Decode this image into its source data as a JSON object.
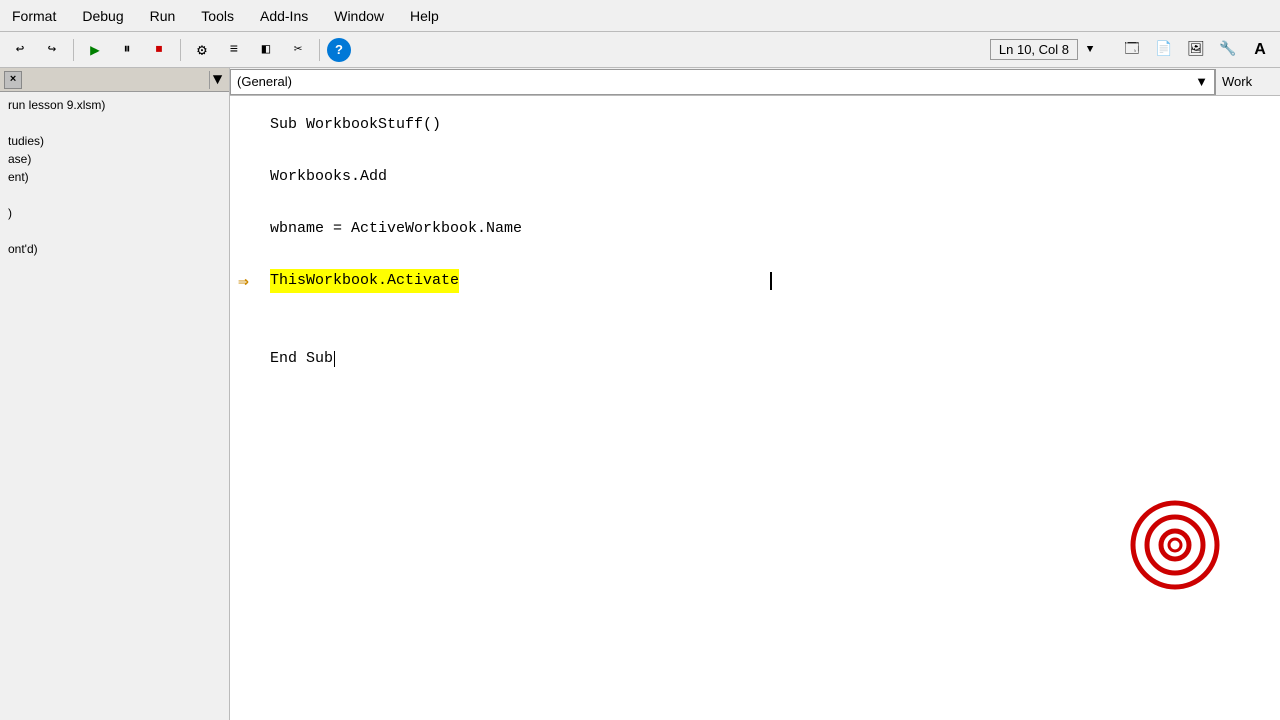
{
  "menu": {
    "items": [
      "Format",
      "Debug",
      "Run",
      "Tools",
      "Add-Ins",
      "Window",
      "Help"
    ]
  },
  "toolbar": {
    "buttons": [
      {
        "name": "undo-btn",
        "icon": "↩",
        "label": "Undo"
      },
      {
        "name": "redo-btn",
        "icon": "↪",
        "label": "Redo"
      },
      {
        "name": "run-btn",
        "icon": "▶",
        "label": "Run"
      },
      {
        "name": "pause-btn",
        "icon": "⏸",
        "label": "Pause"
      },
      {
        "name": "stop-btn",
        "icon": "⏹",
        "label": "Stop"
      },
      {
        "name": "macro-btn",
        "icon": "⚙",
        "label": "Macro"
      },
      {
        "name": "step-btn",
        "icon": "≡",
        "label": "Step"
      },
      {
        "name": "userform-btn",
        "icon": "◧",
        "label": "UserForm"
      },
      {
        "name": "options-btn",
        "icon": "✂",
        "label": "Options"
      },
      {
        "name": "help-btn",
        "icon": "?",
        "label": "Help"
      }
    ],
    "status": "Ln 10, Col 8",
    "overflow_icon": "▼"
  },
  "sidebar": {
    "close_label": "×",
    "items": [
      {
        "label": "run lesson 9.xlsm)",
        "indent": 0
      },
      {
        "label": "",
        "indent": 0
      },
      {
        "label": "tudies)",
        "indent": 1
      },
      {
        "label": "ase)",
        "indent": 1
      },
      {
        "label": "ent)",
        "indent": 1
      },
      {
        "label": "",
        "indent": 0
      },
      {
        "label": ")",
        "indent": 1
      },
      {
        "label": "",
        "indent": 0
      },
      {
        "label": "ont'd)",
        "indent": 1
      }
    ]
  },
  "editor": {
    "dropdown_value": "(General)",
    "work_label": "Work",
    "dropdown_arrow": "▼",
    "code_lines": [
      {
        "text": "Sub WorkbookStuff()",
        "highlighted": false,
        "arrow": false
      },
      {
        "text": "",
        "highlighted": false,
        "arrow": false
      },
      {
        "text": "Workbooks.Add",
        "highlighted": false,
        "arrow": false
      },
      {
        "text": "",
        "highlighted": false,
        "arrow": false
      },
      {
        "text": "wbname = ActiveWorkbook.Name",
        "highlighted": false,
        "arrow": false
      },
      {
        "text": "",
        "highlighted": false,
        "arrow": false
      },
      {
        "text": "ThisWorkbook.Activate",
        "highlighted": true,
        "arrow": true
      },
      {
        "text": "",
        "highlighted": false,
        "arrow": false
      },
      {
        "text": "",
        "highlighted": false,
        "arrow": false
      },
      {
        "text": "End Sub",
        "highlighted": false,
        "arrow": false,
        "cursor": true
      }
    ]
  },
  "bullseye": {
    "rings": 3,
    "color": "#cc0000"
  }
}
